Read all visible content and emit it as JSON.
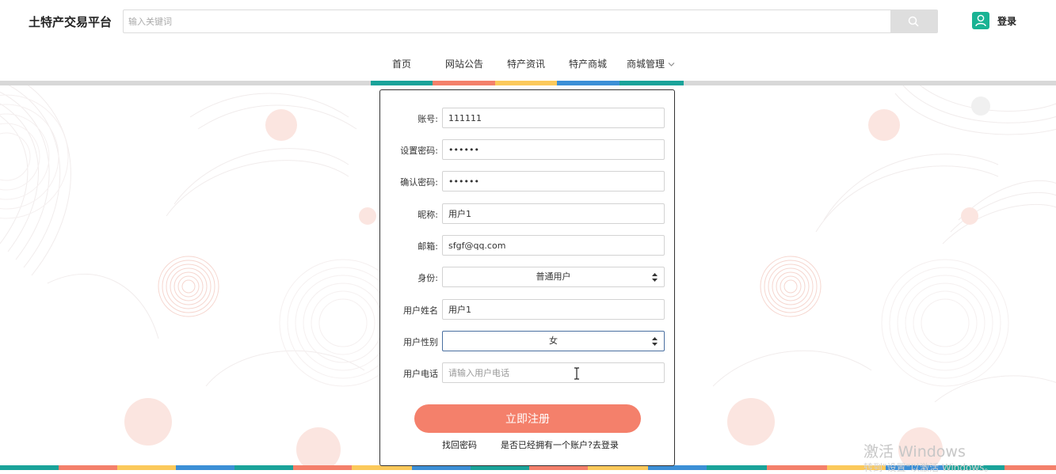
{
  "header": {
    "logo": "土特产交易平台",
    "search_placeholder": "输入关键词",
    "login_label": "登录"
  },
  "nav": {
    "items": [
      "首页",
      "网站公告",
      "特产资讯",
      "特产商城",
      "商城管理"
    ],
    "segment_colors": [
      "#1aa39a",
      "#f4806b",
      "#fbc95b",
      "#3c8fd6",
      "#1aa39a"
    ]
  },
  "form": {
    "fields": [
      {
        "label": "账号:",
        "value": "111111",
        "type": "text"
      },
      {
        "label": "设置密码:",
        "value": "••••••",
        "type": "text"
      },
      {
        "label": "确认密码:",
        "value": "••••••",
        "type": "text"
      },
      {
        "label": "昵称:",
        "value": "用户1",
        "type": "text"
      },
      {
        "label": "邮箱:",
        "value": "sfgf@qq.com",
        "type": "text"
      },
      {
        "label": "身份:",
        "value": "普通用户",
        "type": "select"
      },
      {
        "label": "用户姓名",
        "value": "用户1",
        "type": "text"
      },
      {
        "label": "用户性别",
        "value": "女",
        "type": "select"
      },
      {
        "label": "用户电话",
        "value": "",
        "placeholder": "请输入用户电话",
        "type": "text"
      }
    ],
    "submit_label": "立即注册",
    "forgot_link": "找回密码",
    "login_link": "是否已经拥有一个账户?去登录"
  },
  "watermark": {
    "title": "激活 Windows",
    "subtitle": "转到\"设置\"以激活 Windows。"
  },
  "colors": {
    "accent": "#f4806b",
    "teal": "#1aa39a",
    "yellow": "#fbc95b",
    "blue": "#3c8fd6"
  }
}
